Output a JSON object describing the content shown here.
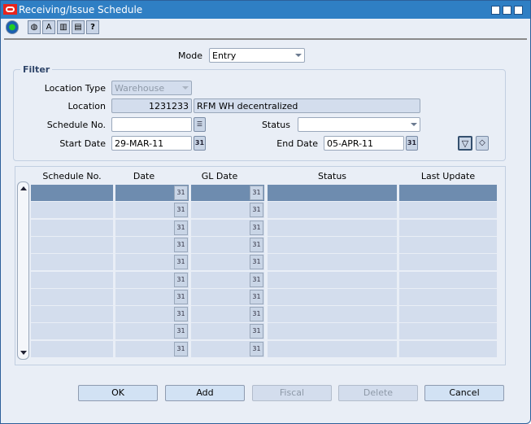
{
  "window": {
    "title": "Receiving/Issue Schedule"
  },
  "toolbar": {
    "icons": [
      "globe-icon",
      "web-help-icon",
      "spell-check-icon",
      "document-icon",
      "print-icon",
      "help-icon"
    ]
  },
  "mode": {
    "label": "Mode",
    "value": "Entry"
  },
  "filter": {
    "title": "Filter",
    "location_type": {
      "label": "Location Type",
      "value": "Warehouse"
    },
    "location": {
      "label": "Location",
      "id": "1231233",
      "name": "RFM WH decentralized"
    },
    "schedule_no": {
      "label": "Schedule No.",
      "value": ""
    },
    "status": {
      "label": "Status",
      "value": ""
    },
    "start_date": {
      "label": "Start Date",
      "value": "29-MAR-11"
    },
    "end_date": {
      "label": "End Date",
      "value": "05-APR-11"
    }
  },
  "table": {
    "columns": [
      "Schedule No.",
      "Date",
      "GL Date",
      "Status",
      "Last Update"
    ],
    "calendar_icon_text": "31",
    "row_count": 10,
    "selected_row": 0
  },
  "buttons": {
    "ok": "OK",
    "add": "Add",
    "fiscal": "Fiscal",
    "delete": "Delete",
    "cancel": "Cancel"
  },
  "colors": {
    "titlebar": "#2f7fc4",
    "background": "#e9eef6",
    "selected_row": "#6e8caf",
    "row": "#d3dded"
  }
}
